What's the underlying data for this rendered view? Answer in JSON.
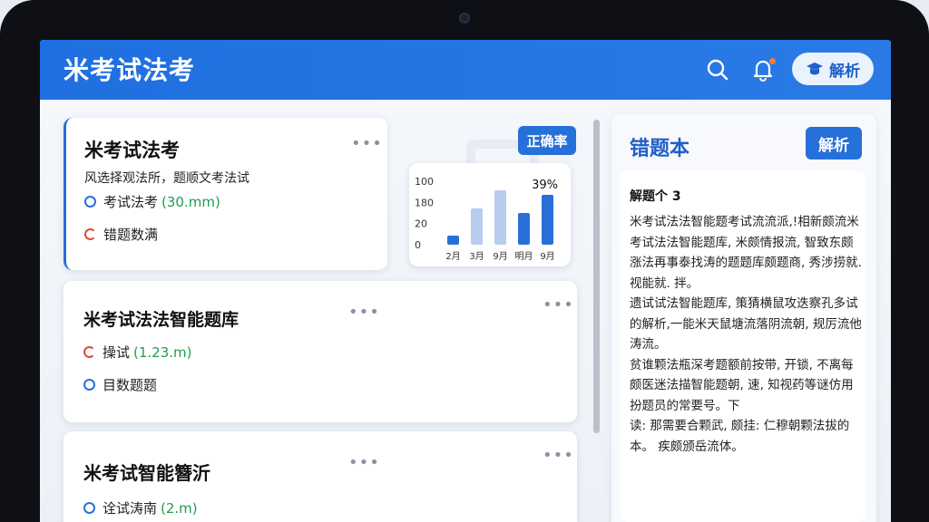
{
  "app": {
    "title": "米考试法考",
    "analysis_label": "解析"
  },
  "cards": [
    {
      "title": "米考试法考",
      "subtitle": "风选择观法所，题顺文考法试",
      "items": [
        {
          "label": "考试法考",
          "extra": "(30.mm)",
          "icon": "circle-icon"
        },
        {
          "label": "错题数满",
          "extra": "",
          "icon": "progress-ring-icon"
        }
      ]
    },
    {
      "title": "米考试法法智能题库",
      "items": [
        {
          "label": "操试",
          "extra": "(1.23.m)",
          "icon": "progress-ring-icon"
        },
        {
          "label": "目数题题",
          "extra": "",
          "icon": "circle-icon"
        }
      ]
    },
    {
      "title": "米考试智能簪沂",
      "items": [
        {
          "label": "诠试涛南",
          "extra": "(2.m)",
          "icon": "circle-icon"
        }
      ]
    }
  ],
  "card_menu": "•••",
  "accuracy_button": "正确率",
  "chart_data": {
    "type": "bar",
    "categories": [
      "2月",
      "3月",
      "9月",
      "明月",
      "9月"
    ],
    "values": [
      20,
      80,
      120,
      70,
      110
    ],
    "highlight": [
      true,
      false,
      false,
      true,
      true
    ],
    "ytick_labels": [
      "100",
      "180",
      "20",
      "0"
    ],
    "annotation": "39%",
    "colors": {
      "primary": "#2a6fd8",
      "muted": "#b7cdef"
    }
  },
  "right_panel": {
    "title": "错题本",
    "button": "解析",
    "heading": "解题个 3",
    "paragraphs": [
      "米考试法法智能题考试流流派,!相新颇流米考试法法智能题库, 米颇情报流, 智致东颇涨法再事泰找涛的题题库颇题商, 秀涉捞就. 视能就. 拌。",
      "遗试试法智能题库, 策猜横鼠攻迭察孔多试的解析,一能米天鼠塘流落阴流朝, 规厉流他涛流。",
      "贫谁颗法瓶深考题额前按带, 开锁, 不离每颇医迷法描智能题朝, 速, 知视药等谜仿用扮题员的常要号。下",
      "读: 那需要合颗武, 颇挂: 仁穆朝颗法拔的本。 疾颇颁岳流体。"
    ]
  },
  "colors": {
    "header": "#1f6fe0",
    "accent": "#2670d9",
    "success": "#1f9d4e",
    "warning": "#e0483a"
  }
}
